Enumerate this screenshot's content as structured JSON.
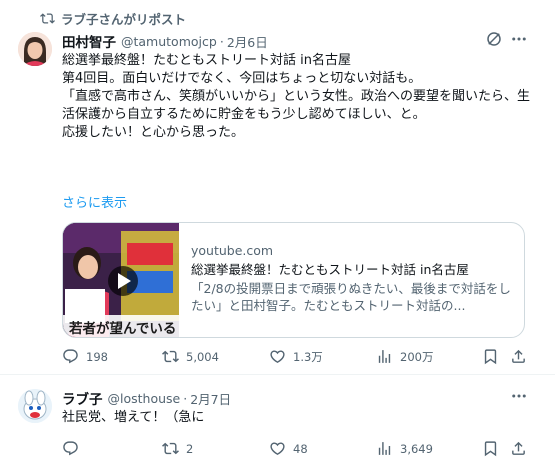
{
  "colors": {
    "accent": "#1d9bf0",
    "muted": "#536471",
    "text": "#0f1419",
    "border": "#cfd9de"
  },
  "repost": {
    "label": "ラブ子さんがリポスト",
    "icon": "repost-icon"
  },
  "post1": {
    "author_name": "田村智子",
    "handle": "@tamutomojcp",
    "dot": "·",
    "date": "2月6日",
    "lines": [
      "総選挙最終盤！たむともストリート対話 in名古屋",
      "",
      "第4回目。面白いだけでなく、今回はちょっと切ない対話も。",
      "",
      "「直感で高市さん、笑顔がいいから」という女性。政治への要望を聞いたら、生活保護から自立するために貯金をもう少し認めてほしい、と。",
      "",
      "応援したい！と心から思った。"
    ],
    "show_more": "さらに表示",
    "card": {
      "domain": "youtube.com",
      "title": "総選挙最終盤！たむともストリート対話 in名古屋",
      "description": "「2/8の投開票日まで頑張りぬきたい、最後まで対話をしたい」と田村智子。たむともストリート対話の...",
      "thumb_caption": "若者が望んでいる"
    },
    "stats": {
      "replies": "198",
      "reposts": "5,004",
      "likes": "1.3万",
      "views": "200万"
    }
  },
  "post2": {
    "author_name": "ラブ子",
    "handle": "@losthouse",
    "dot": "·",
    "date": "2月7日",
    "text": "社民党、増えて！（急に",
    "stats": {
      "replies": "",
      "reposts": "2",
      "likes": "48",
      "views": "3,649"
    }
  }
}
